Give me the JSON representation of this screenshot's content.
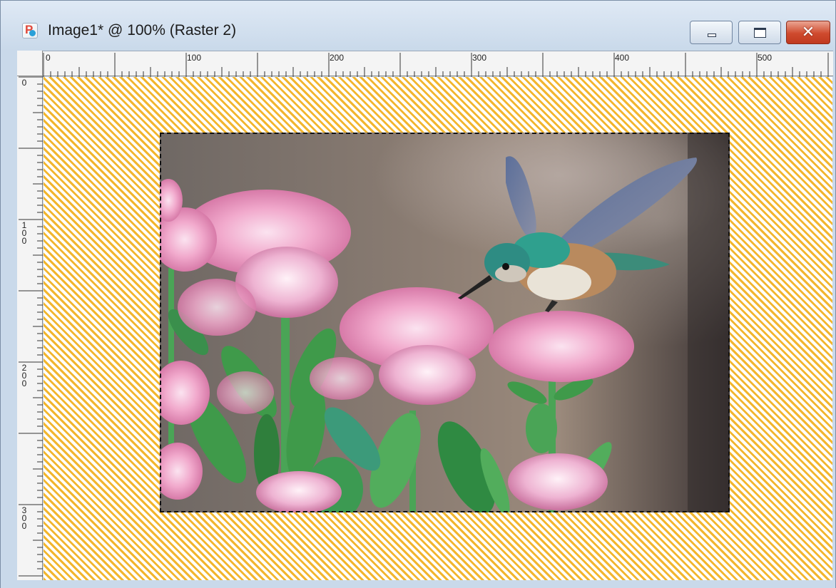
{
  "window": {
    "title": "Image1* @ 100% (Raster 2)",
    "app_icon": "paintshop-pro-icon"
  },
  "controls": {
    "minimize_icon": "minimize-icon",
    "maximize_icon": "maximize-icon",
    "close_icon": "close-icon",
    "close_glyph": "✕"
  },
  "rulers": {
    "horizontal_labels": [
      "0",
      "100",
      "200",
      "300",
      "400",
      "500"
    ],
    "vertical_labels": [
      "0",
      "100",
      "200",
      "300"
    ]
  },
  "canvas": {
    "background_pattern": "diagonal-stripes",
    "stripe_color": "#f2b62e",
    "selection": "marching-ants",
    "image_content": "hummingbird-with-pink-sedum-flowers"
  }
}
